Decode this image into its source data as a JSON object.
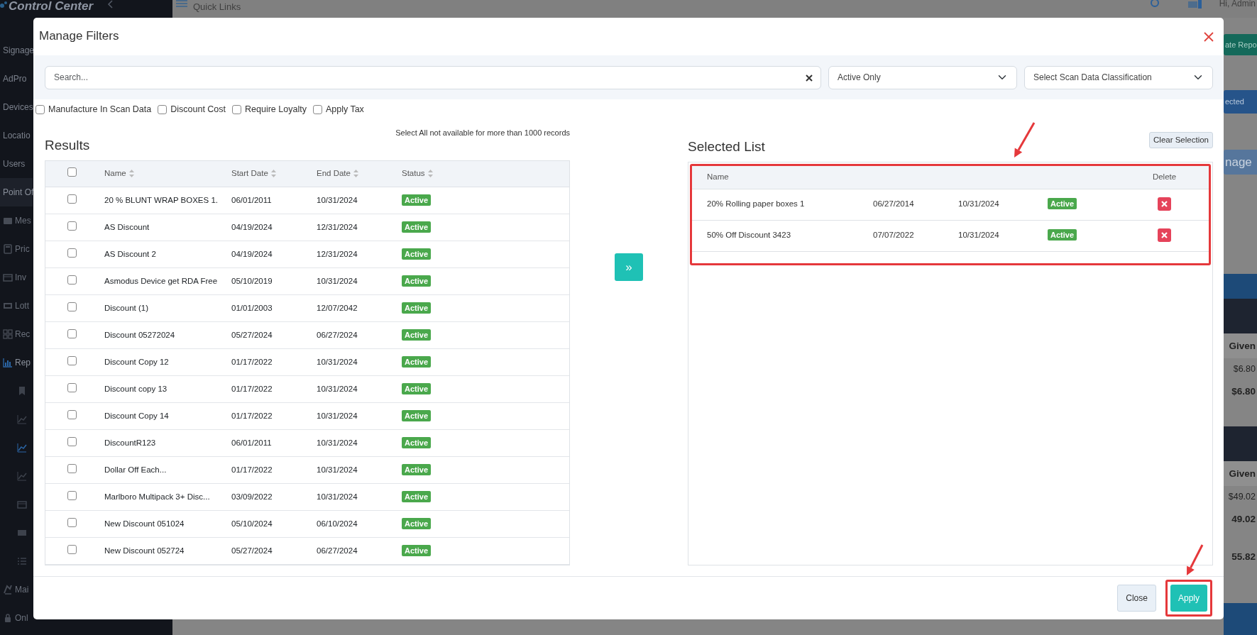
{
  "app": {
    "logo_text": "Control Center",
    "header_title": "Quick Links",
    "greeting": "Hi, Admin"
  },
  "sidebar": {
    "items": [
      {
        "label": "Signage",
        "kind": "section",
        "selected": false
      },
      {
        "label": "AdPro",
        "kind": "section",
        "selected": false
      },
      {
        "label": "Devices",
        "kind": "section",
        "selected": false
      },
      {
        "label": "Locatio",
        "kind": "section",
        "selected": false
      },
      {
        "label": "Users",
        "kind": "section",
        "selected": false
      },
      {
        "label": "Point Of",
        "kind": "section",
        "selected": true
      },
      {
        "label": "Mes",
        "kind": "sub",
        "selected": false
      },
      {
        "label": "Pric",
        "kind": "sub",
        "selected": false
      },
      {
        "label": "Inv",
        "kind": "sub",
        "selected": false
      },
      {
        "label": "Lott",
        "kind": "sub",
        "selected": false
      },
      {
        "label": "Rec",
        "kind": "sub",
        "selected": false
      },
      {
        "label": "Rep",
        "kind": "sub",
        "selected": true,
        "children": [
          {
            "selected": false
          },
          {
            "selected": false
          },
          {
            "selected": true
          },
          {
            "selected": false
          },
          {
            "selected": false
          },
          {
            "selected": false
          },
          {
            "selected": false
          }
        ]
      },
      {
        "label": "Mai",
        "kind": "sub",
        "selected": false
      },
      {
        "label": "Onl",
        "kind": "sub",
        "selected": false
      }
    ]
  },
  "report_panel": {
    "action_buttons": [
      {
        "label": "ate Repo",
        "kind": "success"
      },
      {
        "label": "ected",
        "kind": "primary"
      },
      {
        "label": "nage",
        "kind": "light"
      }
    ],
    "tables": [
      {
        "heading": "Given",
        "value": "$6.80",
        "total": "$6.80"
      },
      {
        "heading": "Given",
        "value": "$49.02",
        "total": "49.02"
      }
    ],
    "grand_total": "55.82"
  },
  "modal": {
    "title": "Manage Filters",
    "search": {
      "placeholder": "Search..."
    },
    "status_filter": {
      "value": "Active Only"
    },
    "classification_filter": {
      "value": "Select Scan Data Classification"
    },
    "options": [
      {
        "label": "Manufacture In Scan Data",
        "checked": false
      },
      {
        "label": "Discount Cost",
        "checked": false
      },
      {
        "label": "Require Loyalty",
        "checked": false
      },
      {
        "label": "Apply Tax",
        "checked": false
      }
    ],
    "results": {
      "title": "Results",
      "note": "Select All not available for more than 1000 records",
      "all_checked": false,
      "columns": [
        "Name",
        "Start Date",
        "End Date",
        "Status"
      ],
      "rows": [
        {
          "name": "20 % BLUNT WRAP BOXES 1.",
          "start": "06/01/2011",
          "end": "10/31/2024",
          "status": "Active",
          "checked": false
        },
        {
          "name": "AS Discount",
          "start": "04/19/2024",
          "end": "12/31/2024",
          "status": "Active",
          "checked": false
        },
        {
          "name": "AS Discount 2",
          "start": "04/19/2024",
          "end": "12/31/2024",
          "status": "Active",
          "checked": false
        },
        {
          "name": "Asmodus Device get RDA Free",
          "start": "05/10/2019",
          "end": "10/31/2024",
          "status": "Active",
          "checked": false
        },
        {
          "name": "Discount (1)",
          "start": "01/01/2003",
          "end": "12/07/2042",
          "status": "Active",
          "checked": false
        },
        {
          "name": "Discount 05272024",
          "start": "05/27/2024",
          "end": "06/27/2024",
          "status": "Active",
          "checked": false
        },
        {
          "name": "Discount Copy 12",
          "start": "01/17/2022",
          "end": "10/31/2024",
          "status": "Active",
          "checked": false
        },
        {
          "name": "Discount copy 13",
          "start": "01/17/2022",
          "end": "10/31/2024",
          "status": "Active",
          "checked": false
        },
        {
          "name": "Discount Copy 14",
          "start": "01/17/2022",
          "end": "10/31/2024",
          "status": "Active",
          "checked": false
        },
        {
          "name": "DiscountR123",
          "start": "06/01/2011",
          "end": "10/31/2024",
          "status": "Active",
          "checked": false
        },
        {
          "name": "Dollar Off Each...",
          "start": "01/17/2022",
          "end": "10/31/2024",
          "status": "Active",
          "checked": false
        },
        {
          "name": "Marlboro Multipack 3+ Disc...",
          "start": "03/09/2022",
          "end": "10/31/2024",
          "status": "Active",
          "checked": false
        },
        {
          "name": "New Discount 051024",
          "start": "05/10/2024",
          "end": "06/10/2024",
          "status": "Active",
          "checked": false
        },
        {
          "name": "New Discount 052724",
          "start": "05/27/2024",
          "end": "06/27/2024",
          "status": "Active",
          "checked": false
        }
      ]
    },
    "move_button": {
      "label": "»"
    },
    "selected_list": {
      "title": "Selected List",
      "clear_label": "Clear Selection",
      "highlighted": true,
      "columns": [
        "Name",
        "Delete"
      ],
      "rows": [
        {
          "name": "20% Rolling paper boxes 1",
          "start": "06/27/2014",
          "end": "10/31/2024",
          "status": "Active"
        },
        {
          "name": "50% Off Discount 3423",
          "start": "07/07/2022",
          "end": "10/31/2024",
          "status": "Active"
        }
      ]
    },
    "buttons": [
      {
        "label": "Close",
        "kind": "secondary",
        "highlighted": false
      },
      {
        "label": "Apply",
        "kind": "primary",
        "highlighted": true
      }
    ]
  }
}
